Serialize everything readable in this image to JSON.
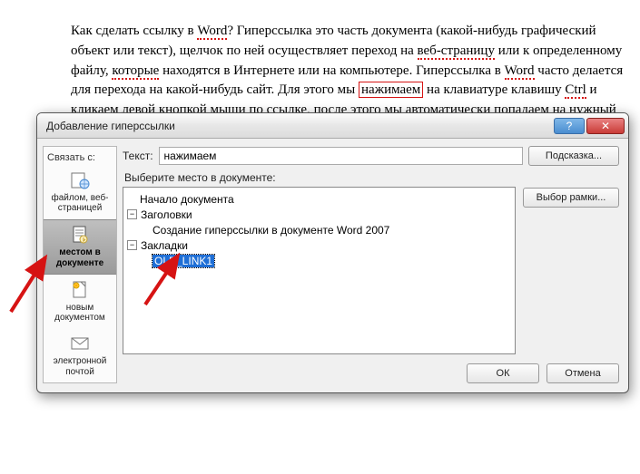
{
  "document_text": {
    "p1": "Как сделать ссылку в ",
    "word": "Word",
    "p2": "? Гиперссылка это часть документа (какой-нибудь графический объект или текст), щелчок по ней осуществляет переход на ",
    "web": "веб-страницу",
    "p3": " или к определенному файлу, ",
    "which": "которые",
    "p4": " находятся в Интернете или на компьютере. Гиперссылка в ",
    "word2": "Word",
    "p5": " часто делается  для перехода на какой-нибудь сайт. Для этого мы ",
    "press": "нажимаем",
    "p6": " на клавиатуре клавишу ",
    "ctrl": "Ctrl",
    "p7": " и ",
    "click": "кликаем",
    "p8": " левой кнопкой мыши по ссылке, после этого мы автоматически попадаем на нужный нам сайт или"
  },
  "dialog": {
    "title": "Добавление гиперссылки",
    "sidebar_label": "Связать с:",
    "items": {
      "file": "файлом, веб-страницей",
      "place": "местом в документе",
      "newdoc": "новым документом",
      "email": "электронной почтой"
    },
    "text_label": "Текст:",
    "text_value": "нажимаем",
    "hint_btn": "Подсказка...",
    "tree_label": "Выберите место в документе:",
    "tree": {
      "root": "Начало документа",
      "heads": "Заголовки",
      "head1": "Создание гиперссылки в документе Word 2007",
      "bookmarks": "Закладки",
      "bm1": "OLE_LINK1"
    },
    "frame_btn": "Выбор рамки...",
    "ok": "ОК",
    "cancel": "Отмена"
  }
}
